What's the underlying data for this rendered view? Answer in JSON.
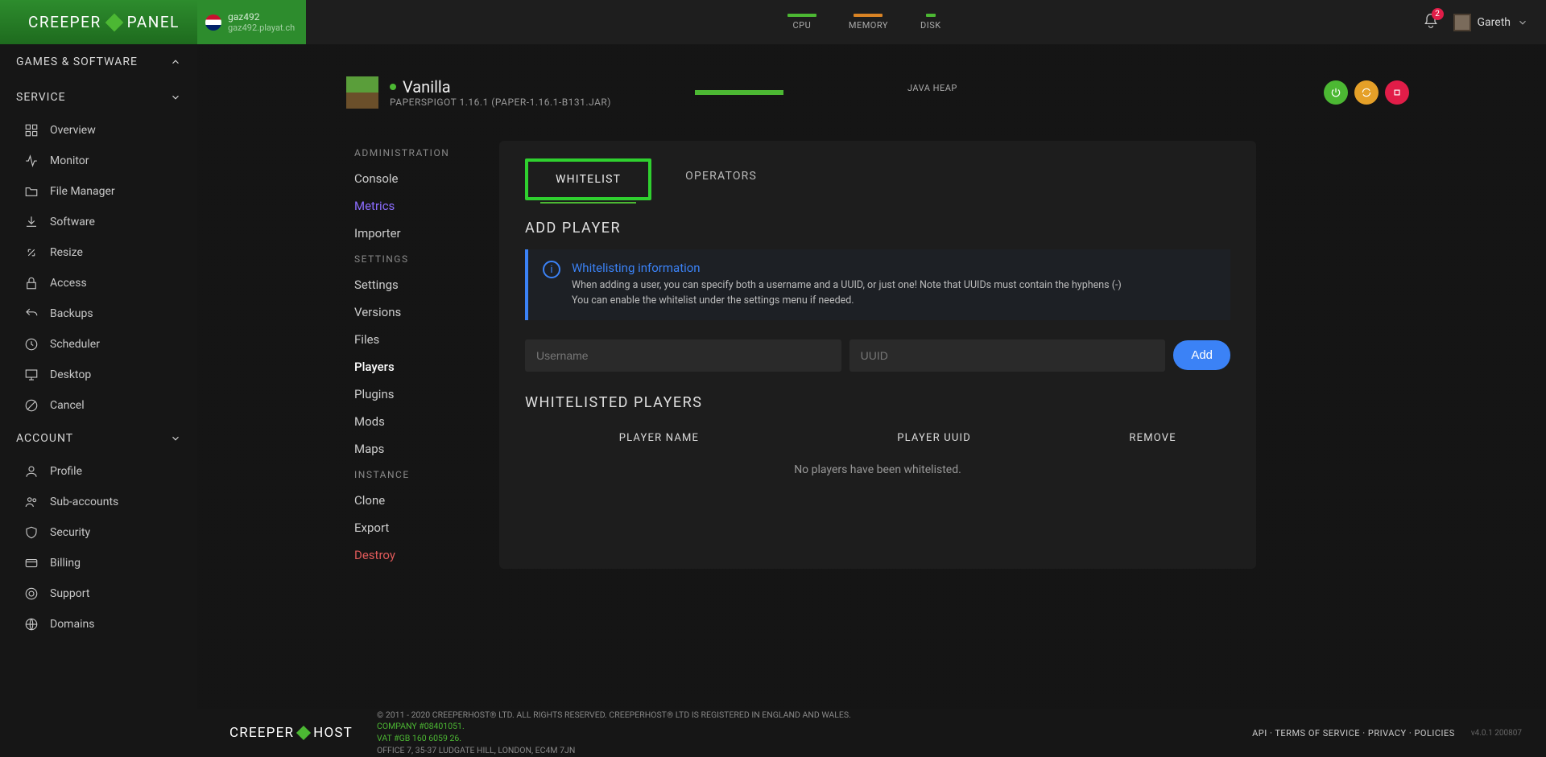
{
  "brand": {
    "logo_left": "CREEPER",
    "logo_right": "PANEL",
    "footer_left": "CREEPER",
    "footer_right": "HOST"
  },
  "server_badge": {
    "name": "gaz492",
    "host": "gaz492.playat.ch"
  },
  "metrics": {
    "cpu": "CPU",
    "memory": "MEMORY",
    "disk": "DISK"
  },
  "topright": {
    "notif_count": "2",
    "username": "Gareth"
  },
  "sidebar": {
    "sections": {
      "games": "GAMES & SOFTWARE",
      "service": "SERVICE",
      "account": "ACCOUNT"
    },
    "service_items": [
      "Overview",
      "Monitor",
      "File Manager",
      "Software",
      "Resize",
      "Access",
      "Backups",
      "Scheduler",
      "Desktop",
      "Cancel"
    ],
    "account_items": [
      "Profile",
      "Sub-accounts",
      "Security",
      "Billing",
      "Support",
      "Domains"
    ]
  },
  "server": {
    "name": "Vanilla",
    "subtitle": "PAPERSPIGOT 1.16.1 (PAPER-1.16.1-B131.JAR)",
    "heap_label": "JAVA HEAP"
  },
  "submenu": {
    "admin_hdr": "ADMINISTRATION",
    "admin": [
      "Console",
      "Metrics",
      "Importer"
    ],
    "settings_hdr": "SETTINGS",
    "settings": [
      "Settings",
      "Versions",
      "Files",
      "Players",
      "Plugins",
      "Mods",
      "Maps"
    ],
    "instance_hdr": "INSTANCE",
    "instance": [
      "Clone",
      "Export",
      "Destroy"
    ]
  },
  "tabs": {
    "whitelist": "WHITELIST",
    "operators": "OPERATORS"
  },
  "addplayer": {
    "heading": "ADD PLAYER",
    "info_title": "Whitelisting information",
    "info_line1": "When adding a user, you can specify both a username and a UUID, or just one! Note that UUIDs must contain the hyphens (-)",
    "info_line2": "You can enable the whitelist under the settings menu if needed.",
    "username_ph": "Username",
    "uuid_ph": "UUID",
    "add_btn": "Add"
  },
  "whitelisted": {
    "heading": "WHITELISTED PLAYERS",
    "col_name": "PLAYER NAME",
    "col_uuid": "PLAYER UUID",
    "col_remove": "REMOVE",
    "empty": "No players have been whitelisted."
  },
  "footer": {
    "copyright": "© 2011 - 2020 CREEPERHOST® LTD. ALL RIGHTS RESERVED. CREEPERHOST® LTD IS REGISTERED IN ENGLAND AND WALES.",
    "company": "COMPANY #08401051.",
    "vat": "VAT #GB 160 6059 26.",
    "address": "OFFICE 7, 35-37 LUDGATE HILL, LONDON, EC4M 7JN",
    "links": {
      "api": "API",
      "tos": "TERMS OF SERVICE",
      "privacy": "PRIVACY",
      "policies": "POLICIES"
    },
    "version": "v4.0.1 200807"
  }
}
